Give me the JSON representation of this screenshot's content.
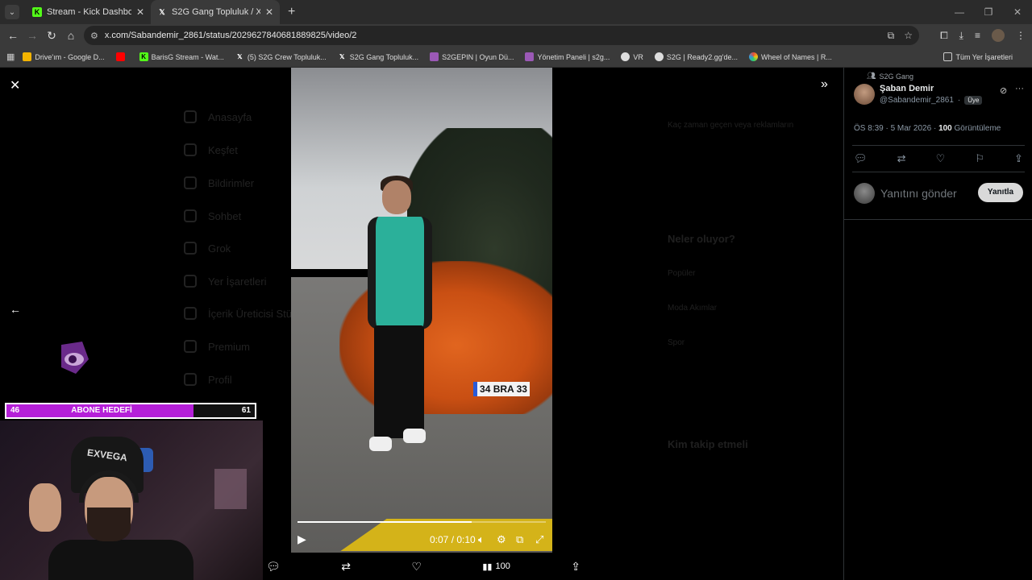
{
  "browser": {
    "tabs": [
      {
        "title": "Stream - Kick Dashboard",
        "fav_color": "#53fc18",
        "fav_glyph": "K"
      },
      {
        "title": "S2G Gang Topluluk / X",
        "fav_color": "#ffffff",
        "fav_glyph": "X"
      }
    ],
    "url": "x.com/Sabandemir_2861/status/2029627840681889825/video/2",
    "bookmarks": [
      {
        "label": "Drive'ım - Google D...",
        "color": "#f4b400"
      },
      {
        "label": "",
        "color": "#ff0000"
      },
      {
        "label": "BarisG Stream - Wat...",
        "color": "#53fc18"
      },
      {
        "label": "(5) S2G Crew Topluluk...",
        "color": "#ffffff"
      },
      {
        "label": "S2G Gang Topluluk...",
        "color": "#ffffff"
      },
      {
        "label": "S2GEPIN | Oyun Dü...",
        "color": "#9b59b6"
      },
      {
        "label": "Yönetim Paneli | s2g...",
        "color": "#9b59b6"
      },
      {
        "label": "VR",
        "color": "#dddddd"
      },
      {
        "label": "S2G | Ready2.gg'de...",
        "color": "#dddddd"
      },
      {
        "label": "Wheel of Names | R...",
        "color": "#e74c3c"
      }
    ],
    "all_bookmarks": "Tüm Yer İşaretleri"
  },
  "ghost_nav": [
    "Anasayfa",
    "Keşfet",
    "Bildirimler",
    "Sohbet",
    "Grok",
    "Yer İşaretleri",
    "İçerik Üreticisi Stüdyosu",
    "Premium",
    "Profil"
  ],
  "ghost_right": [
    "Kaç zaman geçen veya reklamların",
    "Neler oluyor?",
    "Popüler",
    "Moda Akımlar",
    "Spor",
    "Kim takip etmeli"
  ],
  "video": {
    "time": "0:07 / 0:10",
    "progress_fraction": 0.7,
    "plate": "34 BRA 33"
  },
  "actions": {
    "views": "100"
  },
  "stream_overlay": {
    "goal_left": "46",
    "goal_title": "ABONE HEDEFİ",
    "goal_right": "61",
    "goal_fraction": 0.754,
    "chair_text": "EXVEGA"
  },
  "tweet": {
    "community": "S2G Gang",
    "author_name": "Şaban Demir",
    "author_handle": "@Sabandemir_2861",
    "member_badge": "Üye",
    "time": "ÖS 8:39 · 5 Mar 2026 · ",
    "views_count": "100",
    "views_label": " Görüntüleme",
    "reply_placeholder": "Yanıtını gönder",
    "reply_button": "Yanıtla"
  }
}
